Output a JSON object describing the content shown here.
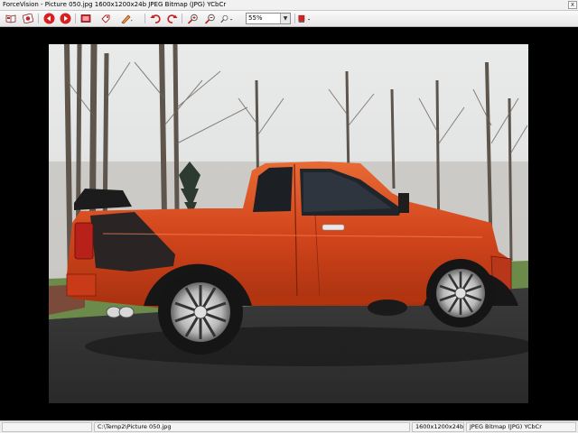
{
  "window": {
    "title": "ForceVision - Picture 050.jpg  1600x1200x24b  JPEG Bitmap (JPG) YCbCr",
    "close_label": "x"
  },
  "toolbar": {
    "buttons": [
      {
        "icon": "open-book-icon"
      },
      {
        "icon": "slideshow-icon"
      },
      {
        "icon": "previous-icon",
        "color": "#d92020"
      },
      {
        "icon": "next-icon",
        "color": "#d92020"
      },
      {
        "icon": "image-icon"
      },
      {
        "icon": "tag-icon"
      },
      {
        "icon": "edit-pen-icon"
      },
      {
        "icon": "undo-icon"
      },
      {
        "icon": "redo-icon"
      },
      {
        "icon": "zoom-in-icon"
      },
      {
        "icon": "zoom-out-icon"
      },
      {
        "icon": "zoom-fit-icon"
      },
      {
        "icon": "color-palette-icon"
      }
    ],
    "zoom_value": "55%"
  },
  "status": {
    "path": "C:\\Temp2\\Picture 050.jpg",
    "dimensions": "1600x1200x24b",
    "format": "JPEG Bitmap (JPG) YCbCr"
  },
  "photo": {
    "subject": "red pickup truck"
  },
  "colors": {
    "accent_red": "#d92020",
    "truck_body": "#d2451c"
  }
}
